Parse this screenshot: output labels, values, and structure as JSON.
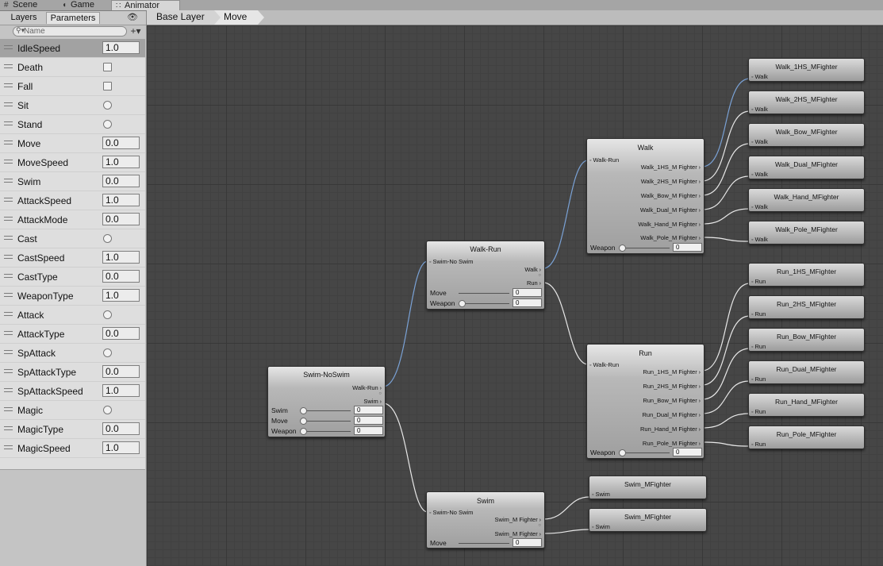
{
  "window_tabs": [
    {
      "label": "Scene",
      "icon": "grid-icon"
    },
    {
      "label": "Game",
      "icon": "pacman-icon"
    },
    {
      "label": "Animator",
      "icon": "animator-icon",
      "active": true
    }
  ],
  "left_panel": {
    "tabs": [
      "Layers",
      "Parameters"
    ],
    "active_tab": "Parameters",
    "search_placeholder": "Name",
    "parameters": [
      {
        "name": "IdleSpeed",
        "type": "float",
        "value": "1.0",
        "selected": true
      },
      {
        "name": "Death",
        "type": "bool"
      },
      {
        "name": "Fall",
        "type": "bool"
      },
      {
        "name": "Sit",
        "type": "trigger"
      },
      {
        "name": "Stand",
        "type": "trigger"
      },
      {
        "name": "Move",
        "type": "float",
        "value": "0.0"
      },
      {
        "name": "MoveSpeed",
        "type": "float",
        "value": "1.0"
      },
      {
        "name": "Swim",
        "type": "float",
        "value": "0.0"
      },
      {
        "name": "AttackSpeed",
        "type": "float",
        "value": "1.0"
      },
      {
        "name": "AttackMode",
        "type": "float",
        "value": "0.0"
      },
      {
        "name": "Cast",
        "type": "trigger"
      },
      {
        "name": "CastSpeed",
        "type": "float",
        "value": "1.0"
      },
      {
        "name": "CastType",
        "type": "float",
        "value": "0.0"
      },
      {
        "name": "WeaponType",
        "type": "float",
        "value": "1.0"
      },
      {
        "name": "Attack",
        "type": "trigger"
      },
      {
        "name": "AttackType",
        "type": "float",
        "value": "0.0"
      },
      {
        "name": "SpAttack",
        "type": "trigger"
      },
      {
        "name": "SpAttackType",
        "type": "float",
        "value": "0.0"
      },
      {
        "name": "SpAttackSpeed",
        "type": "float",
        "value": "1.0"
      },
      {
        "name": "Magic",
        "type": "trigger"
      },
      {
        "name": "MagicType",
        "type": "float",
        "value": "0.0"
      },
      {
        "name": "MagicSpeed",
        "type": "float",
        "value": "1.0"
      }
    ]
  },
  "breadcrumb": [
    "Base Layer",
    "Move"
  ],
  "graph": {
    "swim_noswim": {
      "title": "Swim-NoSwim",
      "outputs": [
        "Walk-Run",
        "Swim"
      ],
      "params": [
        {
          "label": "Swim",
          "value": "0"
        },
        {
          "label": "Move",
          "value": "0"
        },
        {
          "label": "Weapon",
          "value": "0"
        }
      ]
    },
    "walk_run": {
      "title": "Walk-Run",
      "input": "Swim-No Swim",
      "outputs": [
        "Walk",
        "Run"
      ],
      "params": [
        {
          "label": "Move",
          "value": "0"
        },
        {
          "label": "Weapon",
          "value": "0"
        }
      ]
    },
    "walk": {
      "title": "Walk",
      "input": "Walk-Run",
      "outputs": [
        "Walk_1HS_M Fighter",
        "Walk_2HS_M Fighter",
        "Walk_Bow_M Fighter",
        "Walk_Dual_M Fighter",
        "Walk_Hand_M Fighter",
        "Walk_Pole_M Fighter"
      ],
      "params": [
        {
          "label": "Weapon",
          "value": "0"
        }
      ]
    },
    "run": {
      "title": "Run",
      "input": "Walk-Run",
      "outputs": [
        "Run_1HS_M Fighter",
        "Run_2HS_M Fighter",
        "Run_Bow_M Fighter",
        "Run_Dual_M Fighter",
        "Run_Hand_M Fighter",
        "Run_Pole_M Fighter"
      ],
      "params": [
        {
          "label": "Weapon",
          "value": "0"
        }
      ]
    },
    "swim": {
      "title": "Swim",
      "input": "Swim-No Swim",
      "outputs": [
        "Swim_M Fighter",
        "Swim_M Fighter"
      ],
      "params": [
        {
          "label": "Move",
          "value": "0"
        }
      ]
    },
    "walk_clips": [
      {
        "title": "Walk_1HS_MFighter",
        "input": "Walk"
      },
      {
        "title": "Walk_2HS_MFighter",
        "input": "Walk"
      },
      {
        "title": "Walk_Bow_MFighter",
        "input": "Walk"
      },
      {
        "title": "Walk_Dual_MFighter",
        "input": "Walk"
      },
      {
        "title": "Walk_Hand_MFighter",
        "input": "Walk"
      },
      {
        "title": "Walk_Pole_MFighter",
        "input": "Walk"
      }
    ],
    "run_clips": [
      {
        "title": "Run_1HS_MFighter",
        "input": "Run"
      },
      {
        "title": "Run_2HS_MFighter",
        "input": "Run"
      },
      {
        "title": "Run_Bow_MFighter",
        "input": "Run"
      },
      {
        "title": "Run_Dual_MFighter",
        "input": "Run"
      },
      {
        "title": "Run_Hand_MFighter",
        "input": "Run"
      },
      {
        "title": "Run_Pole_MFighter",
        "input": "Run"
      }
    ],
    "swim_clips": [
      {
        "title": "Swim_MFighter",
        "input": "Swim"
      },
      {
        "title": "Swim_MFighter",
        "input": "Swim"
      }
    ]
  }
}
